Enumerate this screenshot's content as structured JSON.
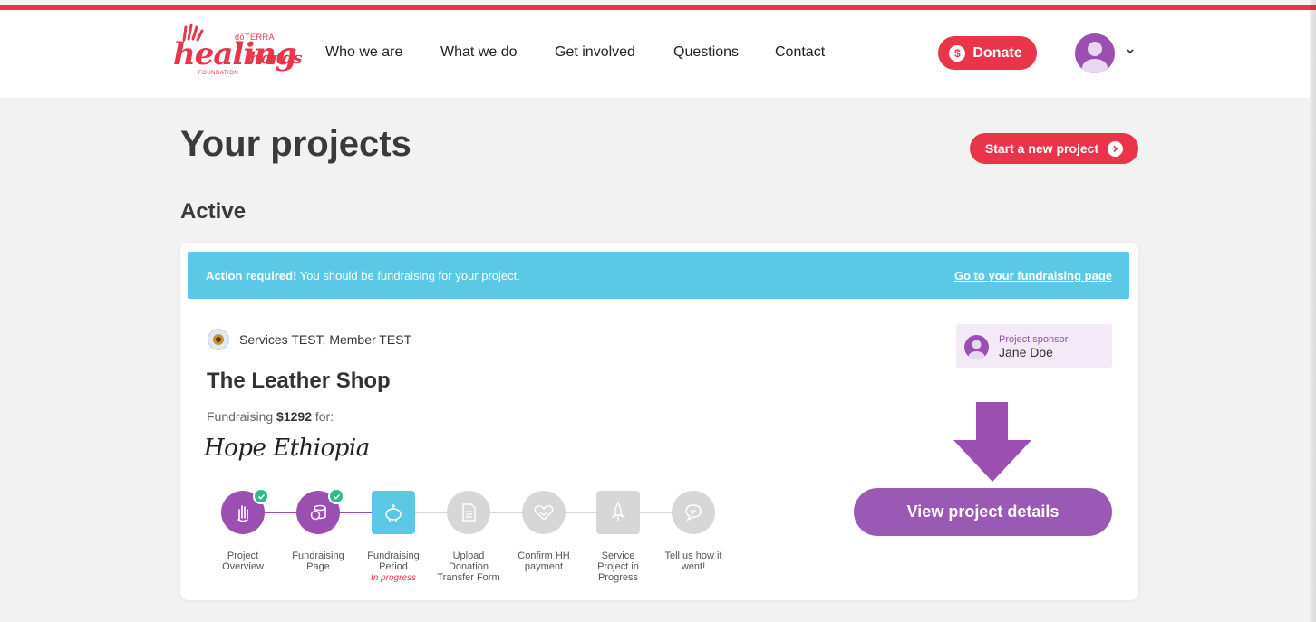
{
  "colors": {
    "brand_red": "#e8354a",
    "purple": "#9b4fb0",
    "banner_blue": "#5bc8e6",
    "check_green": "#2bbc8a",
    "step_grey": "#d7d7d7"
  },
  "header": {
    "logo": {
      "brand": "dōTERRA",
      "word_main": "healing",
      "word_hands": "hands",
      "sub": "FOUNDATION"
    },
    "nav": [
      "Who we are",
      "What we do",
      "Get involved",
      "Questions",
      "Contact"
    ],
    "donate_label": "Donate",
    "donate_icon": "dollar-coin-icon",
    "avatar_icon": "user-avatar-icon",
    "menu_icon": "chevron-down-icon"
  },
  "page": {
    "title": "Your projects",
    "start_button": "Start a new project",
    "section_active": "Active"
  },
  "project": {
    "banner": {
      "strong": "Action required!",
      "message": " You should be fundraising for your project.",
      "link": "Go to your fundraising page"
    },
    "organization": "Services TEST, Member TEST",
    "title": "The Leather Shop",
    "fund_prefix": "Fundraising ",
    "fund_amount": "$1292",
    "fund_suffix": " for:",
    "partner": "Hope Ethiopia",
    "sponsor_label": "Project sponsor",
    "sponsor_name": "Jane Doe",
    "view_button": "View project details",
    "steps": [
      {
        "label": "Project Overview",
        "state": "done",
        "icon": "hand-icon"
      },
      {
        "label": "Fundraising Page",
        "state": "done",
        "icon": "coins-icon"
      },
      {
        "label": "Fundraising Period",
        "state": "current",
        "status": "In progress",
        "icon": "piggy-bank-icon"
      },
      {
        "label": "Upload Donation Transfer Form",
        "state": "todo",
        "icon": "document-icon"
      },
      {
        "label": "Confirm HH payment",
        "state": "todo",
        "icon": "handshake-icon"
      },
      {
        "label": "Service Project in Progress",
        "state": "todo",
        "icon": "rocket-icon"
      },
      {
        "label": "Tell us how it went!",
        "state": "todo",
        "icon": "chat-bubble-icon"
      }
    ]
  }
}
